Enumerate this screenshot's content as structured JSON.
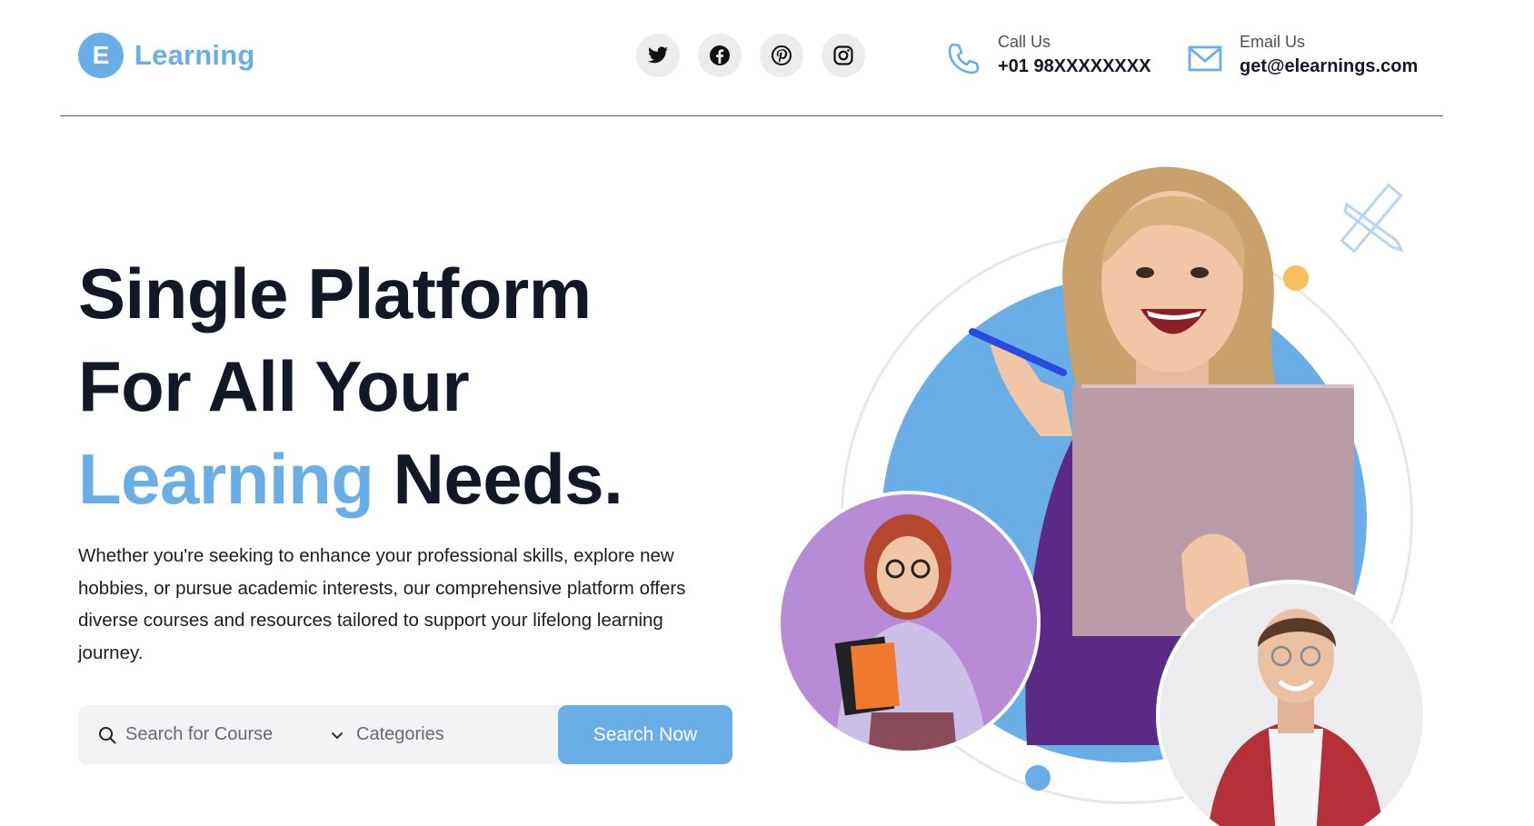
{
  "brand": {
    "badge": "E",
    "name": "Learning",
    "accent_color": "#6aaee8"
  },
  "socials": [
    {
      "name": "twitter-icon"
    },
    {
      "name": "facebook-icon"
    },
    {
      "name": "pinterest-icon"
    },
    {
      "name": "instagram-icon"
    }
  ],
  "contact": {
    "call": {
      "label": "Call Us",
      "value": "+01 98XXXXXXXX",
      "icon": "phone-icon"
    },
    "email": {
      "label": "Email Us",
      "value": "get@elearnings.com",
      "icon": "mail-icon"
    }
  },
  "hero": {
    "title_line1": "Single Platform",
    "title_line2": "For All Your",
    "title_accent": "Learning",
    "title_end": "Needs.",
    "description": "Whether you're seeking to enhance your professional skills, explore new hobbies, or pursue academic interests, our comprehensive platform offers diverse courses and resources tailored to support your lifelong learning journey."
  },
  "search": {
    "placeholder": "Search for Course",
    "category_placeholder": "Categories",
    "button_label": "Search Now"
  }
}
